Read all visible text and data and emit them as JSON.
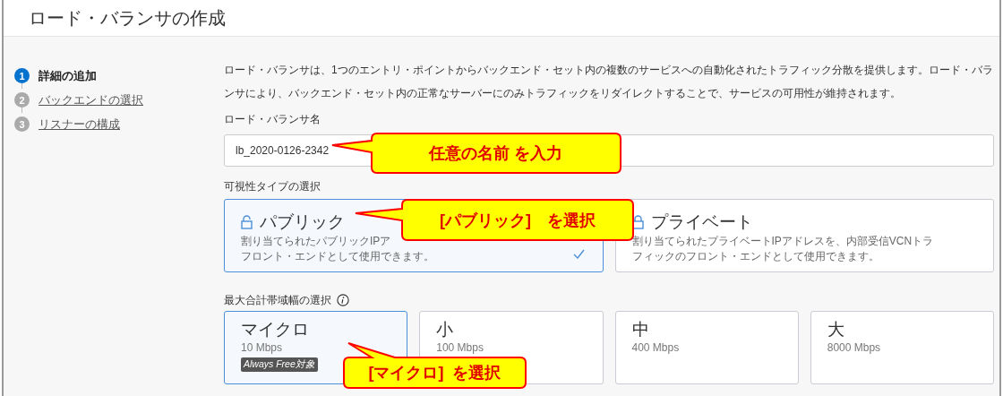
{
  "window": {
    "title": "ロード・バランサの作成"
  },
  "steps": [
    {
      "number": "1",
      "label": "詳細の追加",
      "selected": true
    },
    {
      "number": "2",
      "label": "バックエンドの選択",
      "selected": false
    },
    {
      "number": "3",
      "label": "リスナーの構成",
      "selected": false
    }
  ],
  "description": "ロード・バランサは、1つのエントリ・ポイントからバックエンド・セット内の複数のサービスへの自動化されたトラフィック分散を提供します。ロード・バランサにより、バックエンド・セット内の正常なサーバーにのみトラフィックをリダイレクトすることで、サービスの可用性が維持されます。",
  "name_field": {
    "label": "ロード・バランサ名",
    "value": "lb_2020-0126-2342"
  },
  "visibility": {
    "label": "可視性タイプの選択",
    "options": [
      {
        "title": "パブリック",
        "description": [
          "割り当てられたパブリックIPア",
          "フロント・エンドとして使用できます。"
        ],
        "locked": false,
        "selected": true
      },
      {
        "title": "プライベート",
        "description": [
          "割り当てられたプライベートIPアドレスを、内部受信VCNトラ",
          "フィックのフロント・エンドとして使用できます。"
        ],
        "locked": true,
        "selected": false
      }
    ]
  },
  "bandwidth": {
    "label": "最大合計帯域幅の選択",
    "options": [
      {
        "title": "マイクロ",
        "speed": "10 Mbps",
        "badge": "Always Free対象",
        "selected": true
      },
      {
        "title": "小",
        "speed": "100 Mbps",
        "selected": false
      },
      {
        "title": "中",
        "speed": "400 Mbps",
        "selected": false
      },
      {
        "title": "大",
        "speed": "8000 Mbps",
        "selected": false
      }
    ]
  },
  "callouts": [
    {
      "text": "任意の名前 を入力"
    },
    {
      "text": "[パブリック]　を選択"
    },
    {
      "text": "[マイクロ]  を選択"
    }
  ]
}
